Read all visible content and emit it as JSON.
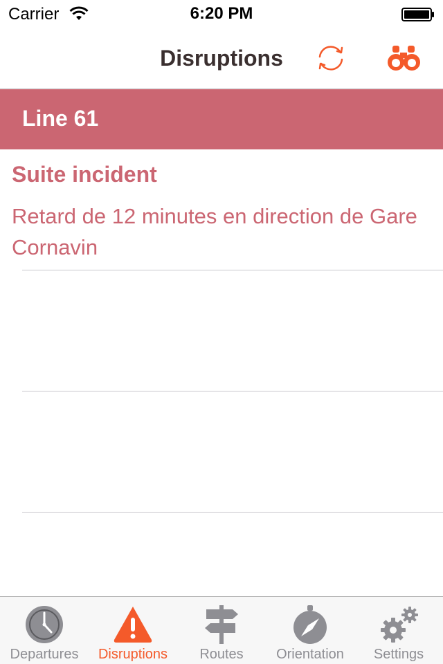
{
  "status_bar": {
    "carrier": "Carrier",
    "time": "6:20 PM"
  },
  "nav": {
    "title": "Disruptions",
    "refresh_icon": "refresh-icon",
    "search_icon": "binoculars-icon"
  },
  "section": {
    "title": "Line 61"
  },
  "disruption": {
    "title": "Suite incident",
    "text": "Retard de 12 minutes en direction de Gare Cornavin"
  },
  "tabs": [
    {
      "label": "Departures",
      "icon": "clock-icon",
      "active": false
    },
    {
      "label": "Disruptions",
      "icon": "warning-icon",
      "active": true
    },
    {
      "label": "Routes",
      "icon": "signpost-icon",
      "active": false
    },
    {
      "label": "Orientation",
      "icon": "compass-icon",
      "active": false
    },
    {
      "label": "Settings",
      "icon": "gears-icon",
      "active": false
    }
  ],
  "colors": {
    "accent": "#f45a2a",
    "line_header": "#cb6672",
    "inactive_tab": "#8e8e93"
  }
}
